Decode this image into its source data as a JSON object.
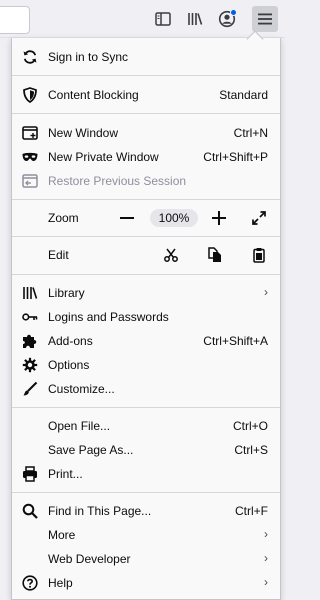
{
  "menu": {
    "sign_in": "Sign in to Sync",
    "content_blocking": "Content Blocking",
    "content_blocking_value": "Standard",
    "new_window": "New Window",
    "new_window_sc": "Ctrl+N",
    "new_private_window": "New Private Window",
    "new_private_window_sc": "Ctrl+Shift+P",
    "restore_session": "Restore Previous Session",
    "zoom_label": "Zoom",
    "zoom_minus": "—",
    "zoom_value": "100%",
    "zoom_plus": "+",
    "edit_label": "Edit",
    "library": "Library",
    "logins": "Logins and Passwords",
    "addons": "Add-ons",
    "addons_sc": "Ctrl+Shift+A",
    "options": "Options",
    "customize": "Customize...",
    "open_file": "Open File...",
    "open_file_sc": "Ctrl+O",
    "save_page": "Save Page As...",
    "save_page_sc": "Ctrl+S",
    "print": "Print...",
    "find": "Find in This Page...",
    "find_sc": "Ctrl+F",
    "more": "More",
    "web_developer": "Web Developer",
    "help": "Help"
  },
  "icons": {
    "chevron": "›"
  },
  "colors": {
    "accent": "#0060df",
    "panel_bg": "#f9f9fa",
    "disabled": "#8f8f9d"
  }
}
